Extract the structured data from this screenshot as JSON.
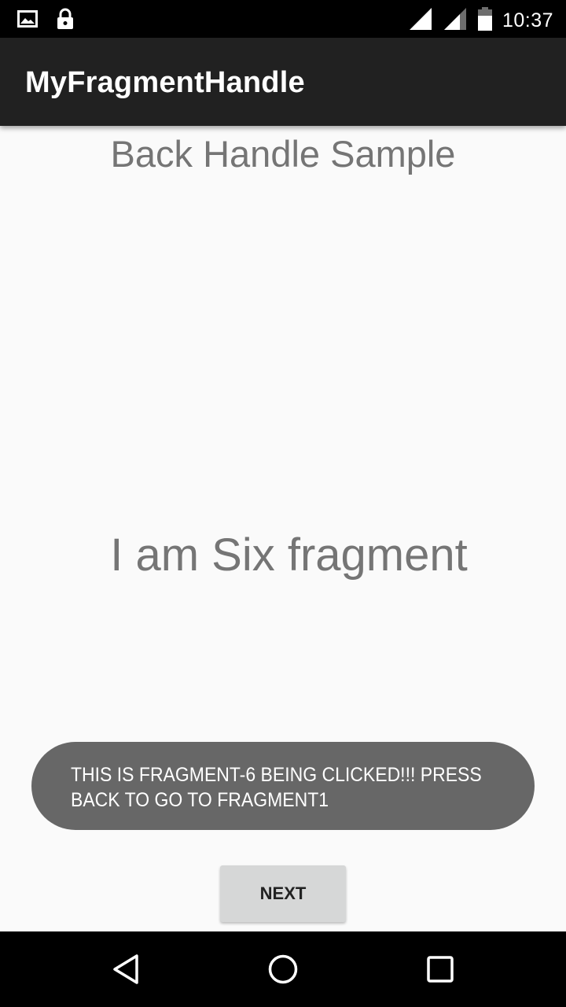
{
  "status_bar": {
    "icons_left": [
      "image-icon",
      "lock-icon"
    ],
    "icons_right": [
      "signal-icon",
      "signal-icon",
      "battery-icon"
    ],
    "time": "10:37"
  },
  "app_bar": {
    "title": "MyFragmentHandle"
  },
  "main": {
    "heading": "Back Handle Sample",
    "fragment_text": "I am Six fragment"
  },
  "toast": {
    "message": "THIS IS FRAGMENT-6 BEING CLICKED!!! PRESS BACK TO GO TO FRAGMENT1"
  },
  "buttons": {
    "next_label": "NEXT"
  },
  "nav_bar": {
    "icons": [
      "back-icon",
      "home-icon",
      "recents-icon"
    ]
  },
  "colors": {
    "status_bar": "#000000",
    "app_bar": "#212121",
    "background": "#fafafa",
    "text_gray": "#757575",
    "toast": "#676767",
    "button": "#d6d7d7"
  }
}
